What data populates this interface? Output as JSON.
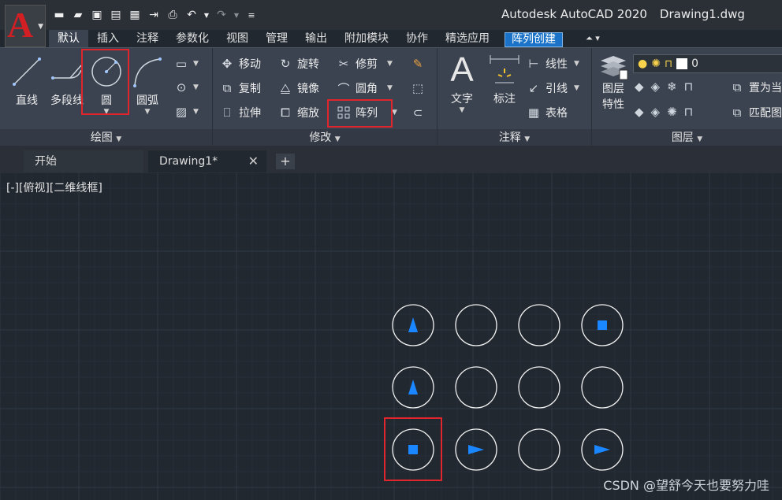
{
  "app": {
    "logo_letter": "A",
    "title": "Autodesk AutoCAD 2020",
    "filename": "Drawing1.dwg"
  },
  "quick_access": [
    "new-icon",
    "open-icon",
    "save-icon",
    "save-as-icon",
    "plot-preview-icon",
    "export-icon",
    "print-icon",
    "undo-icon",
    "redo-icon",
    "customize-icon"
  ],
  "ribbon_tabs": [
    {
      "label": "默认",
      "active": true
    },
    {
      "label": "插入"
    },
    {
      "label": "注释"
    },
    {
      "label": "参数化"
    },
    {
      "label": "视图"
    },
    {
      "label": "管理"
    },
    {
      "label": "输出"
    },
    {
      "label": "附加模块"
    },
    {
      "label": "协作"
    },
    {
      "label": "精选应用"
    },
    {
      "label": "阵列创建",
      "contextual": true
    }
  ],
  "panels": {
    "draw": {
      "title": "绘图",
      "line": "直线",
      "polyline": "多段线",
      "circle": "圆",
      "arc": "圆弧"
    },
    "modify": {
      "title": "修改",
      "move": "移动",
      "rotate": "旋转",
      "trim": "修剪",
      "copy": "复制",
      "mirror": "镜像",
      "fillet": "圆角",
      "stretch": "拉伸",
      "scale": "缩放",
      "array": "阵列"
    },
    "annotation": {
      "title": "注释",
      "text": "文字",
      "dimension": "标注",
      "linear": "线性",
      "leader": "引线",
      "table": "表格"
    },
    "layers": {
      "title": "图层",
      "properties_line1": "图层",
      "properties_line2": "特性",
      "current_layer": "0",
      "set_current": "置为当",
      "match": "匹配图"
    }
  },
  "documents": {
    "start_tab": "开始",
    "drawing_tab": "Drawing1*",
    "close_glyph": "✕",
    "add_glyph": "+"
  },
  "viewport_label": "[-][俯视][二维线框]",
  "array_grid": {
    "rows": 3,
    "cols": 4,
    "cells": [
      [
        "triangle-up",
        "empty",
        "empty",
        "square"
      ],
      [
        "triangle-up",
        "empty",
        "empty",
        "empty"
      ],
      [
        "square",
        "triangle-right",
        "empty",
        "triangle-right"
      ]
    ],
    "highlighted_cell": [
      2,
      0
    ]
  },
  "colors": {
    "canvas_bg": "#212830",
    "ribbon_bg": "#3b4350",
    "contextual_tab": "#1a73c8",
    "highlight_red": "#e0262c",
    "marker_blue": "#1a86ff",
    "logo_red": "#d11f24"
  },
  "watermark": "CSDN @望舒今天也要努力哇"
}
